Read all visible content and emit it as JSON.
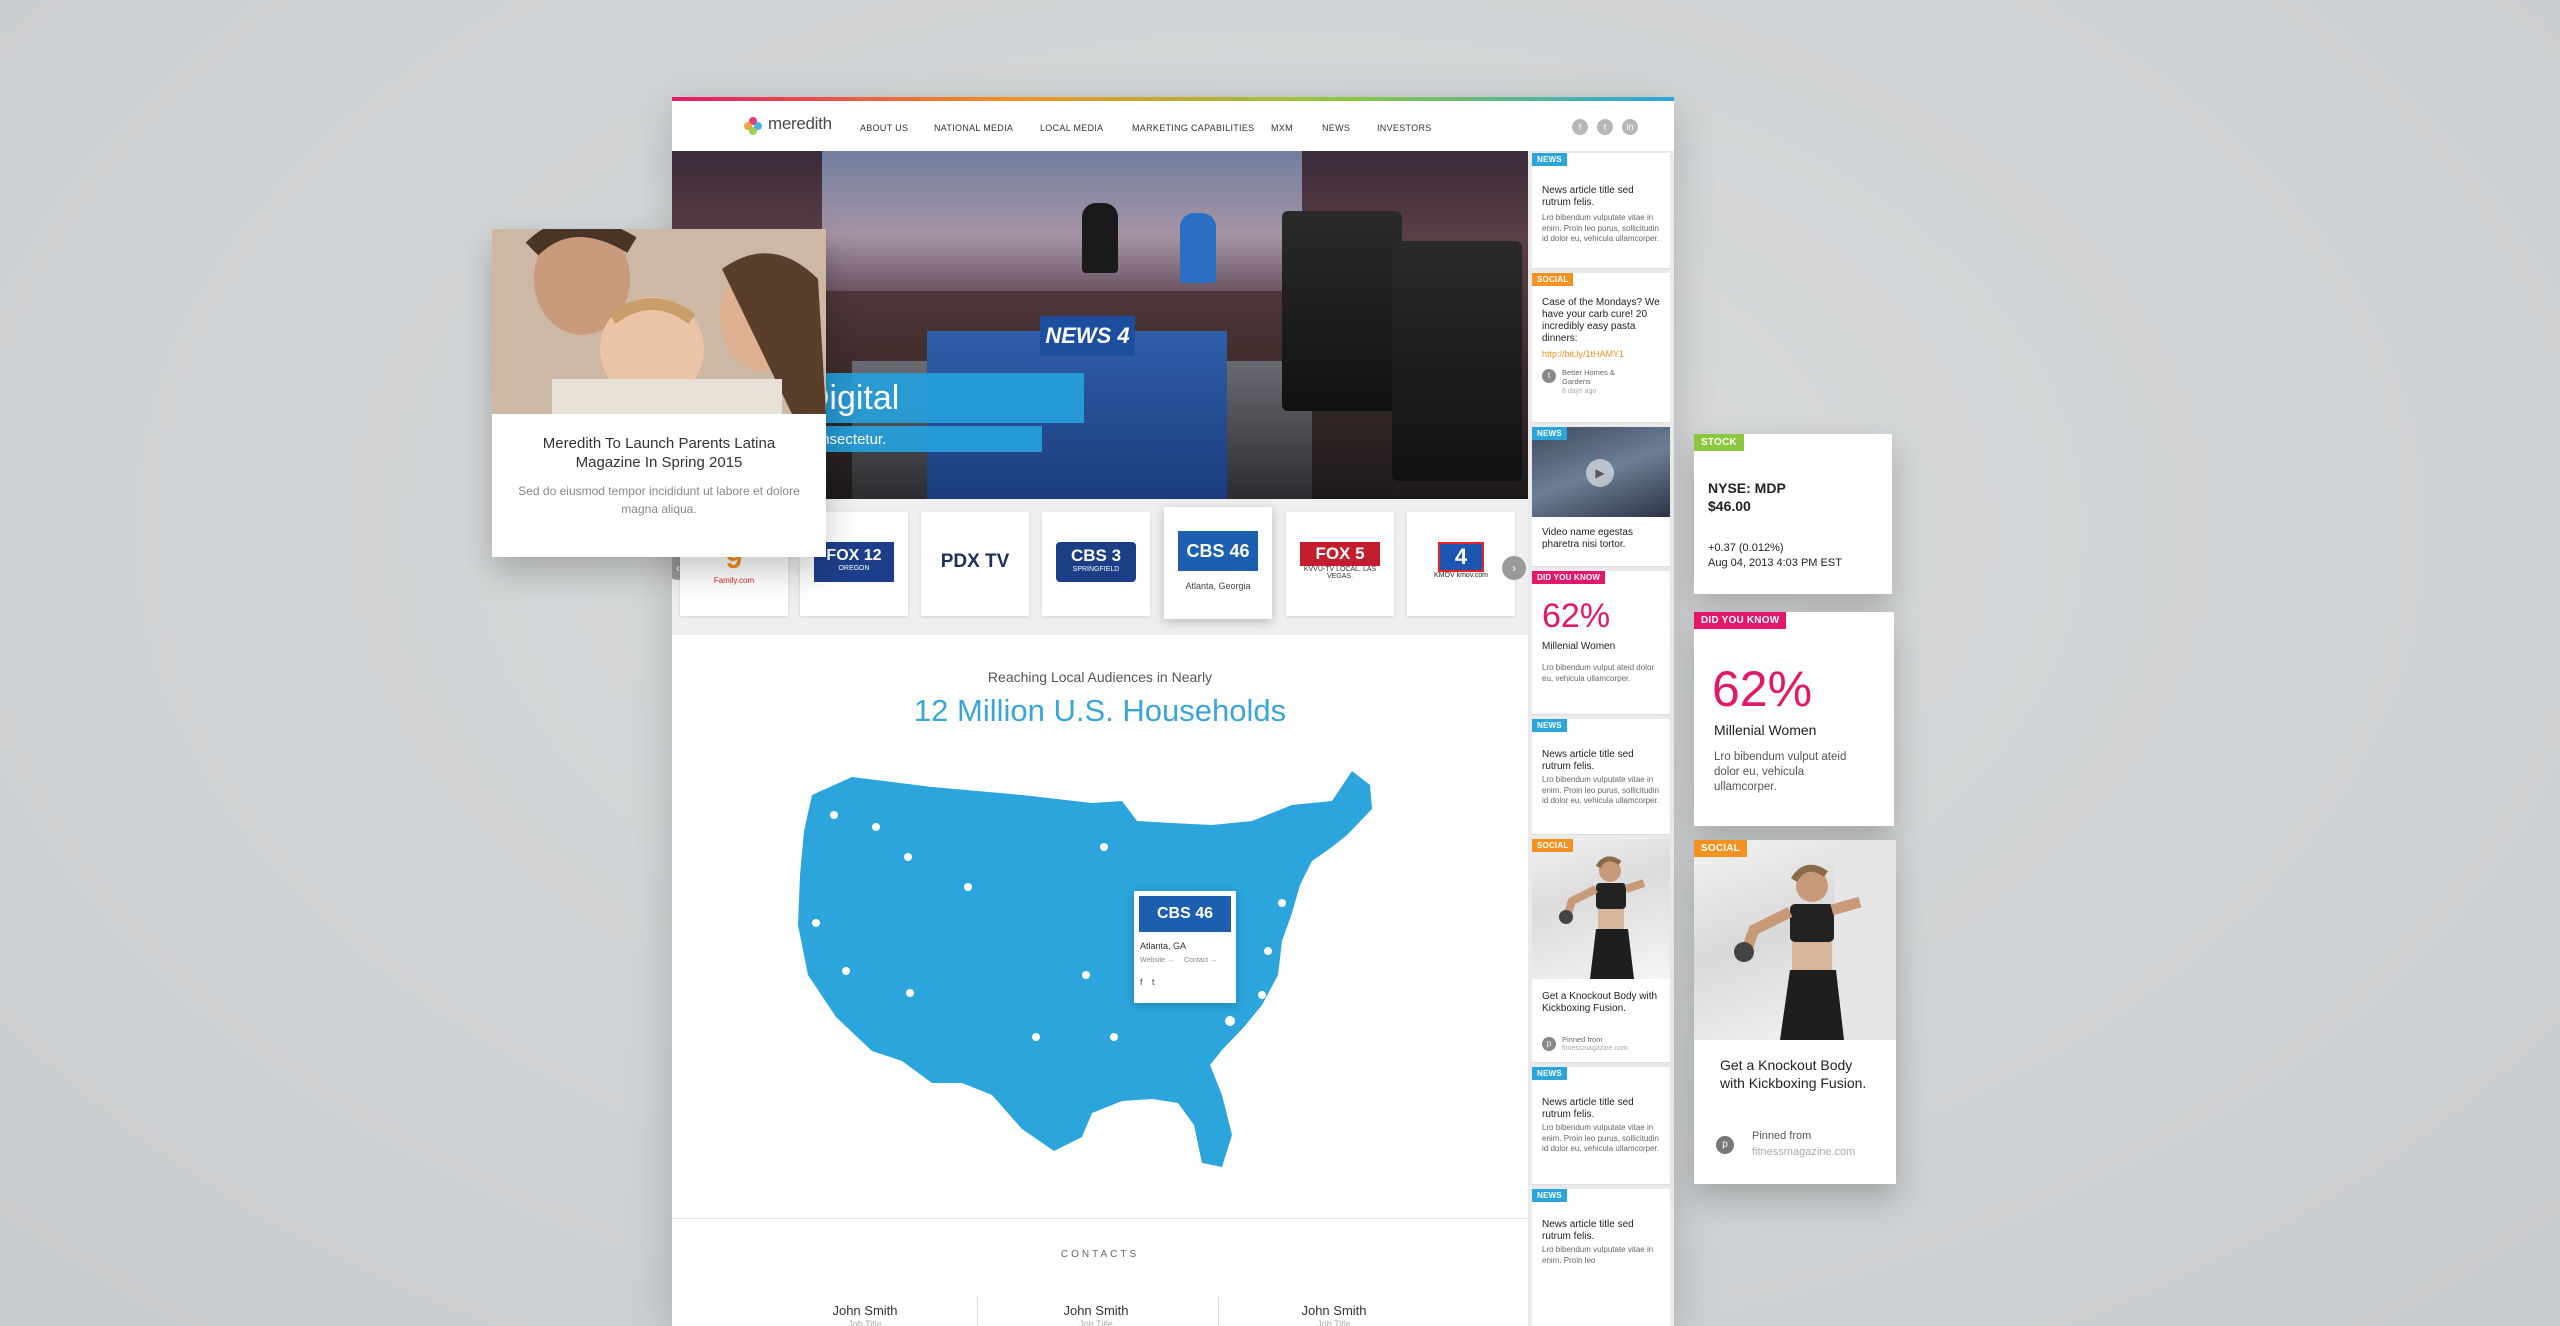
{
  "site": {
    "logo_text": "meredith",
    "nav": [
      "ABOUT US",
      "NATIONAL MEDIA",
      "LOCAL MEDIA",
      "MARKETING CAPABILITIES",
      "MXM",
      "NEWS",
      "INVESTORS"
    ],
    "social_icons": [
      "facebook-icon",
      "twitter-icon",
      "linkedin-icon"
    ]
  },
  "hero": {
    "headline": "dcast & Digital",
    "subline": "um dolor sit amet, consectetur.",
    "desk_sign": "NEWS 4"
  },
  "carousel": {
    "stations": [
      {
        "name": "9",
        "sub": "Family.com"
      },
      {
        "name": "FOX 12",
        "sub": "OREGON"
      },
      {
        "name": "PDX TV",
        "sub": ""
      },
      {
        "name": "CBS 3",
        "sub": "SPRINGFIELD"
      },
      {
        "name": "CBS 46",
        "sub": "Atlanta, Georgia"
      },
      {
        "name": "FOX 5",
        "sub": "KVVU-TV LOCAL. LAS VEGAS."
      },
      {
        "name": "4",
        "sub": "KMOV kmov.com"
      }
    ]
  },
  "map": {
    "reach_text": "Reaching Local Audiences in Nearly",
    "households": "12 Million U.S. Households",
    "popup": {
      "logo": "CBS 46",
      "city": "Atlanta, GA",
      "website": "Website →",
      "contact": "Contact →"
    }
  },
  "contacts": {
    "title": "CONTACTS",
    "people": [
      {
        "name": "John Smith",
        "role": "Job Title"
      },
      {
        "name": "John Smith",
        "role": "Job Title"
      },
      {
        "name": "John Smith",
        "role": "Job Title"
      }
    ]
  },
  "feed": {
    "news1": {
      "tag": "NEWS",
      "title": "News article title sed rutrum felis.",
      "body": "Lro bibendum vulputate vitae in enim. Proin leo purus, sollicitudin id dolor eu, vehicula ullamcorper."
    },
    "social1": {
      "tag": "SOCIAL",
      "title": "Case of the Mondays? We have your carb cure! 20 incredibly easy pasta dinners:",
      "link": "http://bit.ly/1tHAMY1",
      "source": "Better Homes & Gardens",
      "time": "6 days ago"
    },
    "video": {
      "tag": "NEWS",
      "title": "Video name egestas pharetra nisi tortor."
    },
    "dyk": {
      "tag": "DID YOU KNOW",
      "pct": "62%",
      "label": "Millenial Women",
      "body": "Lro bibendum vulput ateid dolor eu, vehicula ullamcorper."
    },
    "news2": {
      "tag": "NEWS",
      "title": "News article title sed rutrum felis.",
      "body": "Lro bibendum vulputate vitae in enim. Proin leo purus, sollicitudin id dolor eu, vehicula ullamcorper."
    },
    "social2": {
      "tag": "SOCIAL",
      "title": "Get a Knockout Body with Kickboxing Fusion.",
      "source": "Pinned from",
      "source_site": "fitnessmagazine.com"
    },
    "news3": {
      "tag": "NEWS",
      "title": "News article title sed rutrum felis.",
      "body": "Lro bibendum vulputate vitae in enim. Proin leo purus, sollicitudin id dolor eu, vehicula ullamcorper."
    },
    "news4": {
      "tag": "NEWS",
      "title": "News article title sed rutrum felis.",
      "body": "Lro bibendum vulputate vitae in enim. Proin leo"
    }
  },
  "float_parents": {
    "title": "Meredith To Launch Parents Latina Magazine In Spring 2015",
    "body": "Sed do eiusmod tempor incididunt ut labore et dolore magna aliqua."
  },
  "float_stock": {
    "tag": "STOCK",
    "ticker": "NYSE: MDP",
    "price": "$46.00",
    "change": "+0.37 (0.012%)",
    "date": "Aug 04, 2013 4:03 PM EST"
  },
  "float_dyk": {
    "tag": "DID YOU KNOW",
    "pct": "62%",
    "label": "Millenial Women",
    "body": "Lro bibendum vulput ateid dolor eu, vehicula ullamcorper."
  },
  "float_social": {
    "tag": "SOCIAL",
    "title": "Get a Knockout Body with Kickboxing Fusion.",
    "source": "Pinned from",
    "source_site": "fitnessmagazine.com"
  },
  "colors": {
    "accent_blue": "#2ca5dd",
    "social_orange": "#f39221",
    "dyk_pink": "#e2196b",
    "stock_green": "#8dc63f"
  }
}
